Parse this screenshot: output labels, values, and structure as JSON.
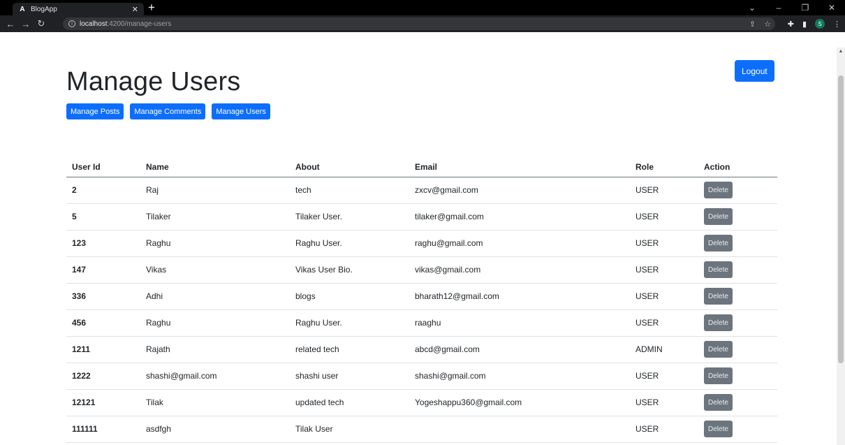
{
  "browser": {
    "tab_title": "BlogApp",
    "tab_favicon": "A",
    "url_host": "localhost",
    "url_path": ":4200/manage-users",
    "profile_initial": "S"
  },
  "page": {
    "title": "Manage Users",
    "logout_label": "Logout",
    "nav": [
      "Manage Posts",
      "Manage Comments",
      "Manage Users"
    ]
  },
  "table": {
    "headers": [
      "User Id",
      "Name",
      "About",
      "Email",
      "Role",
      "Action"
    ],
    "rows": [
      {
        "id": "2",
        "name": "Raj",
        "about": "tech",
        "email": "zxcv@gmail.com",
        "role": "USER",
        "action": "Delete"
      },
      {
        "id": "5",
        "name": "Tilaker",
        "about": "Tilaker User.",
        "email": "tilaker@gmail.com",
        "role": "USER",
        "action": "Delete"
      },
      {
        "id": "123",
        "name": "Raghu",
        "about": "Raghu User.",
        "email": "raghu@gmail.com",
        "role": "USER",
        "action": "Delete"
      },
      {
        "id": "147",
        "name": "Vikas",
        "about": "Vikas User Bio.",
        "email": "vikas@gmail.com",
        "role": "USER",
        "action": "Delete"
      },
      {
        "id": "336",
        "name": "Adhi",
        "about": "blogs",
        "email": "bharath12@gmail.com",
        "role": "USER",
        "action": "Delete"
      },
      {
        "id": "456",
        "name": "Raghu",
        "about": "Raghu User.",
        "email": "raaghu",
        "role": "USER",
        "action": "Delete"
      },
      {
        "id": "1211",
        "name": "Rajath",
        "about": "related tech",
        "email": "abcd@gmail.com",
        "role": "ADMIN",
        "action": "Delete"
      },
      {
        "id": "1222",
        "name": "shashi@gmail.com",
        "about": "shashi user",
        "email": "shashi@gmail.com",
        "role": "USER",
        "action": "Delete"
      },
      {
        "id": "12121",
        "name": "Tilak",
        "about": "updated tech",
        "email": "Yogeshappu360@gmail.com",
        "role": "USER",
        "action": "Delete"
      },
      {
        "id": "111111",
        "name": "asdfgh",
        "about": "Tilak User",
        "email": "",
        "role": "USER",
        "action": "Delete"
      }
    ]
  },
  "colors": {
    "primary": "#0d6efd",
    "secondary": "#6c757d",
    "chrome_bg": "#202124"
  }
}
